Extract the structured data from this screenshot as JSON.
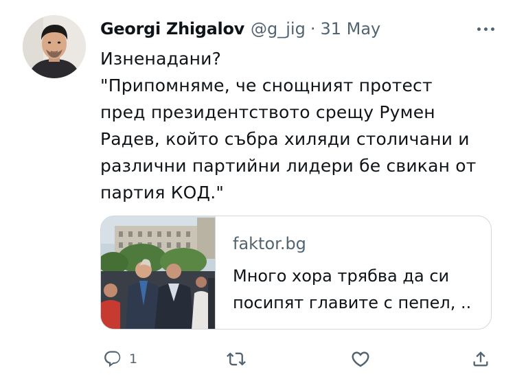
{
  "author": {
    "name": "Georgi Zhigalov",
    "handle": "@g_jig",
    "separator": "·",
    "date": "31 May"
  },
  "tweet": {
    "lines": [
      "Изненадани?",
      "\"Припомняме, че снощният протест",
      "пред президентството срещу Румен",
      "Радев, който събра хиляди столичани и",
      "различни партийни лидери бе свикан от",
      "партия КОД.\""
    ]
  },
  "card": {
    "domain": "faktor.bg",
    "title_lines": [
      "Много хора трябва да си",
      "посипят главите с пепел, .."
    ]
  },
  "actions": {
    "reply_count": "1",
    "icons": [
      "reply-icon",
      "retweet-icon",
      "like-icon",
      "share-icon"
    ]
  },
  "colors": {
    "text": "#0f1419",
    "secondary": "#536471",
    "border": "#cfd9de"
  }
}
